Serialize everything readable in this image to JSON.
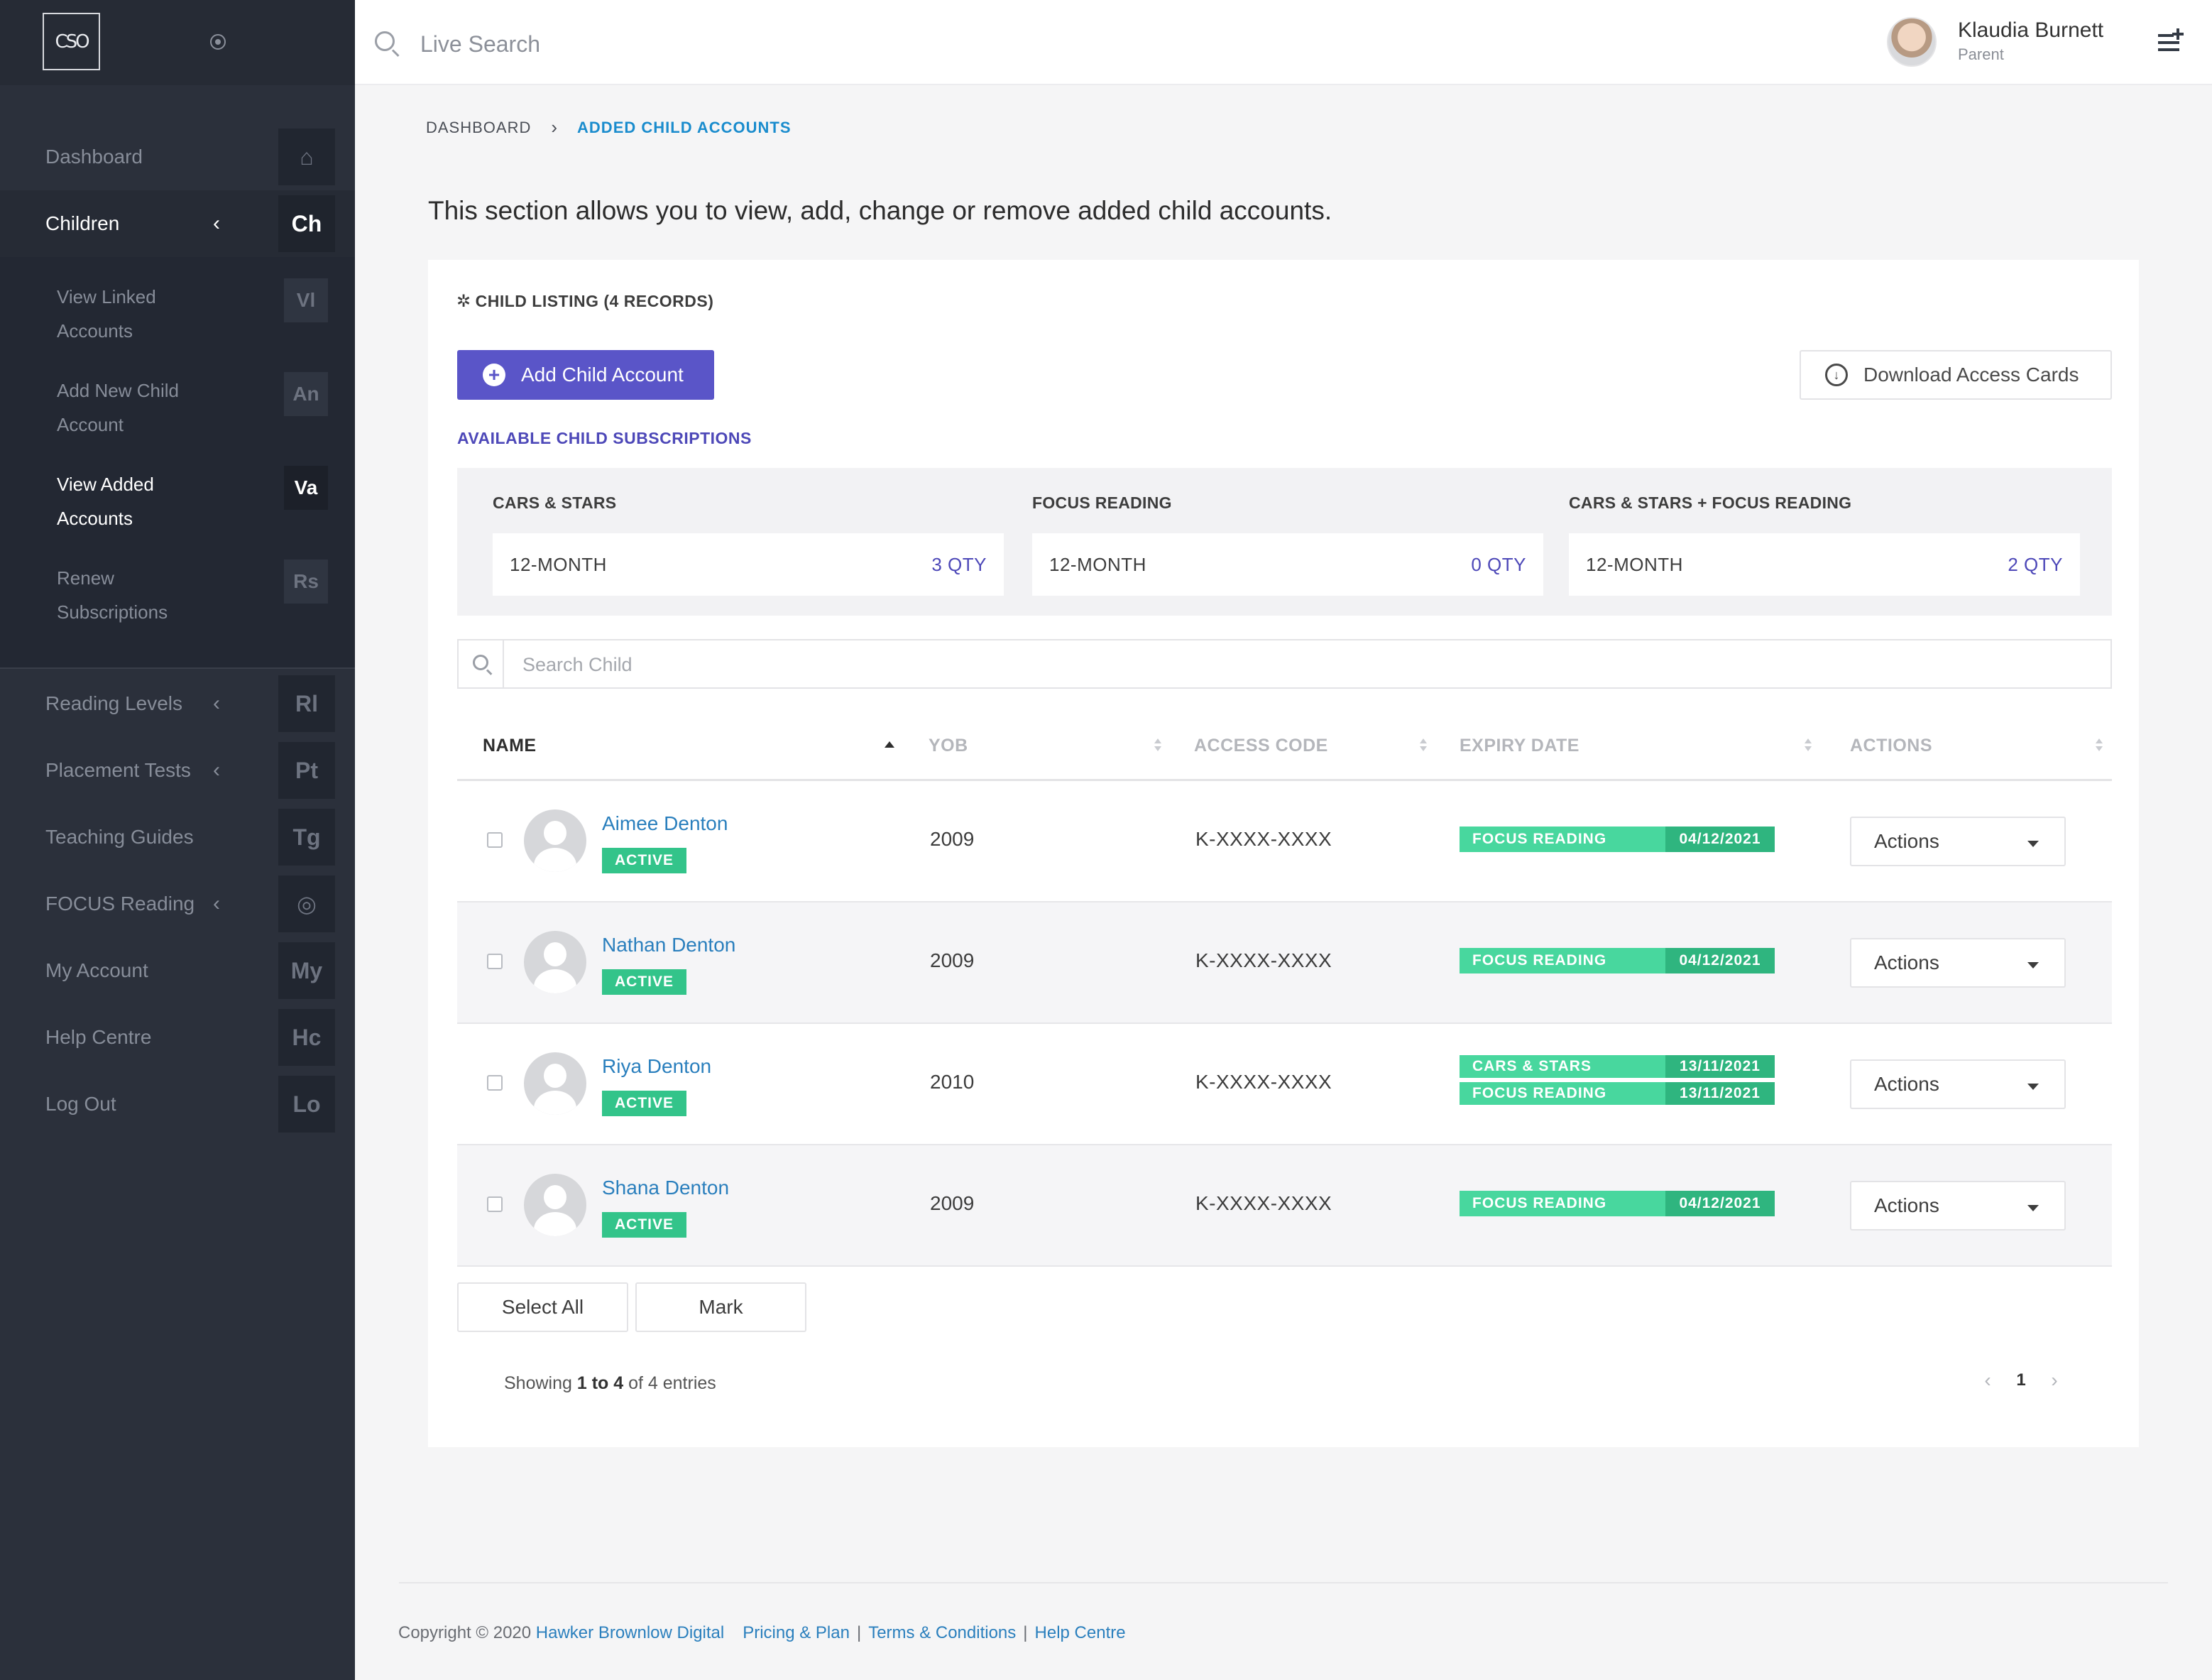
{
  "sidebar": {
    "logo": "CSO",
    "items": [
      {
        "label": "Dashboard",
        "badge": "⌂"
      },
      {
        "label": "Children",
        "badge": "Ch"
      }
    ],
    "children_sub": [
      {
        "label": "View Linked Accounts",
        "badge": "Vl"
      },
      {
        "label": "Add New Child Account",
        "badge": "An"
      },
      {
        "label": "View Added Accounts",
        "badge": "Va"
      },
      {
        "label": "Renew Subscriptions",
        "badge": "Rs"
      }
    ],
    "items_lower": [
      {
        "label": "Reading Levels",
        "badge": "Rl"
      },
      {
        "label": "Placement Tests",
        "badge": "Pt"
      },
      {
        "label": "Teaching Guides",
        "badge": "Tg"
      },
      {
        "label": "FOCUS Reading",
        "badge": "◎"
      },
      {
        "label": "My Account",
        "badge": "My"
      },
      {
        "label": "Help Centre",
        "badge": "Hc"
      },
      {
        "label": "Log Out",
        "badge": "Lo"
      }
    ]
  },
  "header": {
    "search_placeholder": "Live Search",
    "user_name": "Klaudia Burnett",
    "user_role": "Parent"
  },
  "breadcrumb": {
    "home": "DASHBOARD",
    "current": "ADDED CHILD ACCOUNTS"
  },
  "intro": "This section allows you to view, add, change or remove added child accounts.",
  "listing": {
    "title": "CHILD LISTING (4 RECORDS)",
    "add_button": "Add Child Account",
    "download_button": "Download Access Cards",
    "subs_title": "AVAILABLE CHILD SUBSCRIPTIONS",
    "subscriptions": [
      {
        "name": "CARS & STARS",
        "term": "12-MONTH",
        "qty": "3 QTY"
      },
      {
        "name": "FOCUS READING",
        "term": "12-MONTH",
        "qty": "0 QTY"
      },
      {
        "name": "CARS & STARS + FOCUS READING",
        "term": "12-MONTH",
        "qty": "2 QTY"
      }
    ],
    "search_placeholder": "Search Child",
    "columns": {
      "name": "NAME",
      "yob": "YOB",
      "access_code": "ACCESS CODE",
      "expiry": "EXPIRY DATE",
      "actions": "ACTIONS"
    },
    "rows": [
      {
        "name": "Aimee Denton",
        "status": "ACTIVE",
        "yob": "2009",
        "code": "K-XXXX-XXXX",
        "expiry": [
          {
            "product": "FOCUS READING",
            "date": "04/12/2021"
          }
        ],
        "action": "Actions"
      },
      {
        "name": "Nathan Denton",
        "status": "ACTIVE",
        "yob": "2009",
        "code": "K-XXXX-XXXX",
        "expiry": [
          {
            "product": "FOCUS READING",
            "date": "04/12/2021"
          }
        ],
        "action": "Actions"
      },
      {
        "name": "Riya Denton",
        "status": "ACTIVE",
        "yob": "2010",
        "code": "K-XXXX-XXXX",
        "expiry": [
          {
            "product": "CARS & STARS",
            "date": "13/11/2021"
          },
          {
            "product": "FOCUS READING",
            "date": "13/11/2021"
          }
        ],
        "action": "Actions"
      },
      {
        "name": "Shana Denton",
        "status": "ACTIVE",
        "yob": "2009",
        "code": "K-XXXX-XXXX",
        "expiry": [
          {
            "product": "FOCUS READING",
            "date": "04/12/2021"
          }
        ],
        "action": "Actions"
      }
    ],
    "select_all": "Select All",
    "mark": "Mark",
    "showing_prefix": "Showing ",
    "showing_range": "1 to 4",
    "showing_suffix": " of 4 entries",
    "page": "1"
  },
  "footer": {
    "copyright": "Copyright © 2020",
    "company": "Hawker Brownlow Digital",
    "pricing": "Pricing & Plan",
    "terms": "Terms & Conditions",
    "help": "Help Centre"
  },
  "colors": {
    "sidebar_bg": "#2b303b",
    "primary": "#5a55c8",
    "link": "#2a7fbd",
    "active_green": "#33c48a"
  }
}
